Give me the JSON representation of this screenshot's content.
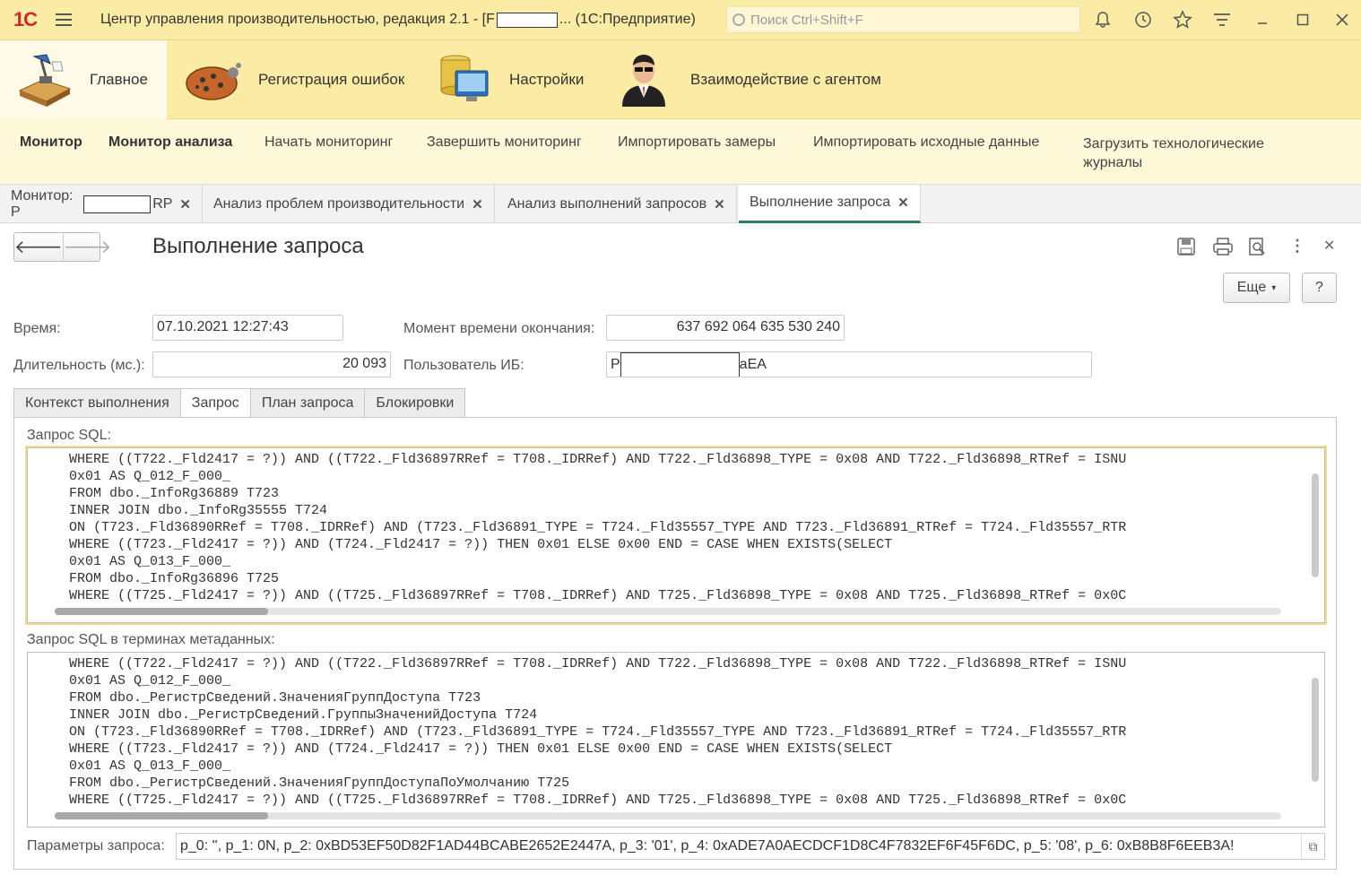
{
  "titlebar": {
    "logo": "1С",
    "title_prefix": "Центр управления производительностью, редакция 2.1 - [F",
    "title_suffix": "... (1С:Предприятие)",
    "search_placeholder": "Поиск Ctrl+Shift+F",
    "icons": [
      "bell-icon",
      "history-icon",
      "star-icon",
      "menu-lines-icon",
      "minimize-icon",
      "maximize-icon",
      "close-icon"
    ]
  },
  "sections": [
    {
      "label": "Главное",
      "icon": "desk-lamp-icon"
    },
    {
      "label": "Регистрация ошибок",
      "icon": "bug-icon"
    },
    {
      "label": "Настройки",
      "icon": "database-monitor-icon"
    },
    {
      "label": "Взаимодействие с агентом",
      "icon": "agent-icon"
    }
  ],
  "nav": [
    {
      "label": "Монитор",
      "bold": true
    },
    {
      "label": "Монитор анализа",
      "bold": true
    },
    {
      "label": "Начать мониторинг"
    },
    {
      "label": "Завершить мониторинг"
    },
    {
      "label": "Импортировать замеры"
    },
    {
      "label": "Импортировать исходные данные"
    },
    {
      "label": "Загрузить технологические журналы"
    }
  ],
  "tabs": [
    {
      "label_prefix": "Монитор: P",
      "label_suffix": "RP"
    },
    {
      "label": "Анализ проблем производительности"
    },
    {
      "label": "Анализ выполнений запросов"
    },
    {
      "label": "Выполнение запроса",
      "active": true
    }
  ],
  "form": {
    "title": "Выполнение запроса",
    "more_label": "Еще",
    "help_label": "?",
    "time_label": "Время:",
    "time_value": "07.10.2021 12:27:43",
    "end_label": "Момент времени окончания:",
    "end_value": "637 692 064 635 530 240",
    "duration_label": "Длительность (мс.):",
    "duration_value": "20 093",
    "user_label": "Пользователь ИБ:",
    "user_prefix": "P",
    "user_suffix": "aEA",
    "page_tabs": [
      {
        "label": "Контекст выполнения"
      },
      {
        "label": "Запрос",
        "active": true
      },
      {
        "label": "План запроса"
      },
      {
        "label": "Блокировки"
      }
    ],
    "sql_label": "Запрос SQL:",
    "sql_text": "WHERE ((T722._Fld2417 = ?)) AND ((T722._Fld36897RRef = T708._IDRRef) AND T722._Fld36898_TYPE = 0x08 AND T722._Fld36898_RTRef = ISNU\n0x01 AS Q_012_F_000_\nFROM dbo._InfoRg36889 T723\nINNER JOIN dbo._InfoRg35555 T724\nON (T723._Fld36890RRef = T708._IDRRef) AND (T723._Fld36891_TYPE = T724._Fld35557_TYPE AND T723._Fld36891_RTRef = T724._Fld35557_RTR\nWHERE ((T723._Fld2417 = ?)) AND (T724._Fld2417 = ?)) THEN 0x01 ELSE 0x00 END = CASE WHEN EXISTS(SELECT\n0x01 AS Q_013_F_000_\nFROM dbo._InfoRg36896 T725\nWHERE ((T725._Fld2417 = ?)) AND ((T725._Fld36897RRef = T708._IDRRef) AND T725._Fld36898_TYPE = 0x08 AND T725._Fld36898_RTRef = 0x0C",
    "meta_label": "Запрос SQL в терминах метаданных:",
    "meta_text": "WHERE ((T722._Fld2417 = ?)) AND ((T722._Fld36897RRef = T708._IDRRef) AND T722._Fld36898_TYPE = 0x08 AND T722._Fld36898_RTRef = ISNU\n0x01 AS Q_012_F_000_\nFROM dbo._РегистрСведений.ЗначенияГруппДоступа T723\nINNER JOIN dbo._РегистрСведений.ГруппыЗначенийДоступа T724\nON (T723._Fld36890RRef = T708._IDRRef) AND (T723._Fld36891_TYPE = T724._Fld35557_TYPE AND T723._Fld36891_RTRef = T724._Fld35557_RTR\nWHERE ((T723._Fld2417 = ?)) AND (T724._Fld2417 = ?)) THEN 0x01 ELSE 0x00 END = CASE WHEN EXISTS(SELECT\n0x01 AS Q_013_F_000_\nFROM dbo._РегистрСведений.ЗначенияГруппДоступаПоУмолчанию T725\nWHERE ((T725._Fld2417 = ?)) AND ((T725._Fld36897RRef = T708._IDRRef) AND T725._Fld36898_TYPE = 0x08 AND T725._Fld36898_RTRef = 0x0C",
    "params_label": "Параметры запроса:",
    "params_value": "p_0: '', p_1: 0N, p_2: 0xBD53EF50D82F1AD44BCABE2652E2447A, p_3: '01', p_4: 0xADE7A0AECDCF1D8C4F7832EF6F45F6DC, p_5: '08', p_6: 0xB8B8F6EEB3A!"
  }
}
